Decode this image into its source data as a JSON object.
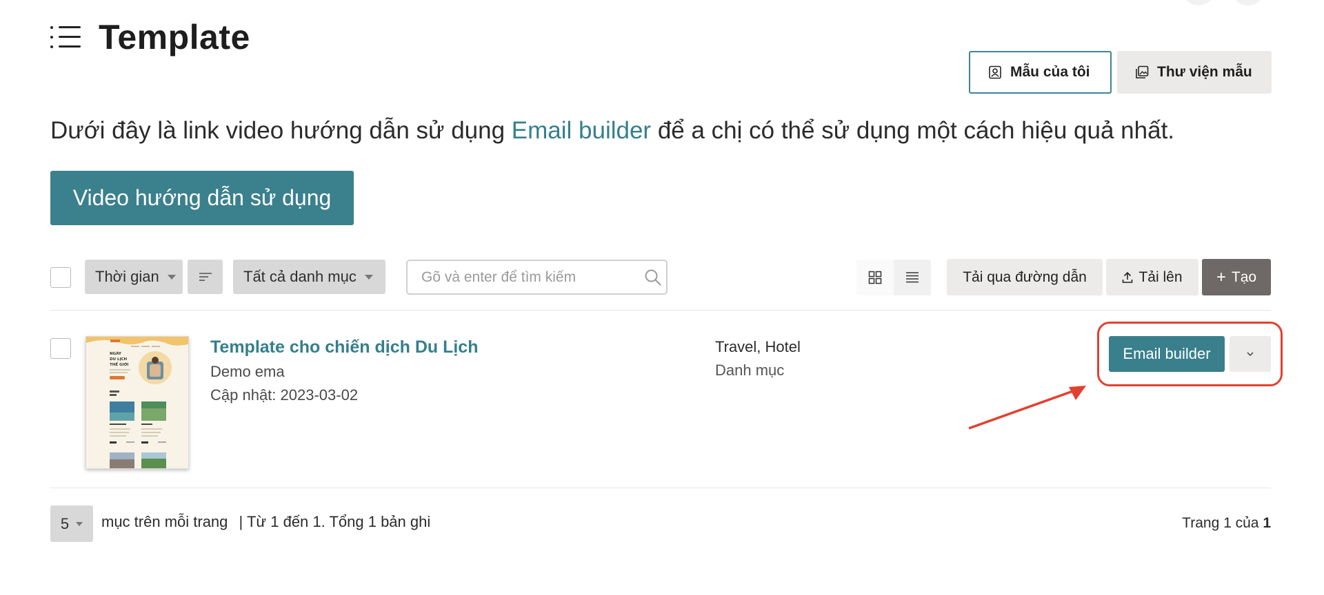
{
  "header": {
    "title": "Template",
    "icon": "list-icon"
  },
  "tabs": [
    {
      "label": "Mẫu của tôi",
      "icon": "user-card-icon",
      "active": true
    },
    {
      "label": "Thư viện mẫu",
      "icon": "gallery-icon",
      "active": false
    }
  ],
  "intro": {
    "before": "Dưới đây là link video hướng dẫn sử dụng ",
    "highlight": "Email builder",
    "after": " để a chị có thể sử dụng một cách hiệu quả nhất."
  },
  "video_button": {
    "label": "Video hướng dẫn sử dụng"
  },
  "toolbar": {
    "sort_time": "Thời gian",
    "category_filter": "Tất cả danh mục",
    "search_placeholder": "Gõ và enter để tìm kiếm",
    "import_url": "Tải qua đường dẫn",
    "upload": "Tải lên",
    "create": "Tạo"
  },
  "templates": [
    {
      "name": "Template cho chiến dịch Du Lịch",
      "subtitle": "Demo ema",
      "updated": "Cập nhật: 2023-03-02",
      "categories": "Travel, Hotel",
      "category_label": "Danh mục",
      "action": "Email builder",
      "thumbnail": {
        "heading": "NGÀY DU LỊCH THẾ GIỚI"
      }
    }
  ],
  "pagination": {
    "per_page": "5",
    "per_page_text": "mục trên mỗi trang",
    "range_text": "| Từ 1 đến 1. Tổng 1 bản ghi",
    "page_prefix": "Trang 1 của",
    "page_total": "1"
  },
  "colors": {
    "accent": "#3b808d",
    "annotation": "#e2402f",
    "create_button": "#6e6866"
  }
}
